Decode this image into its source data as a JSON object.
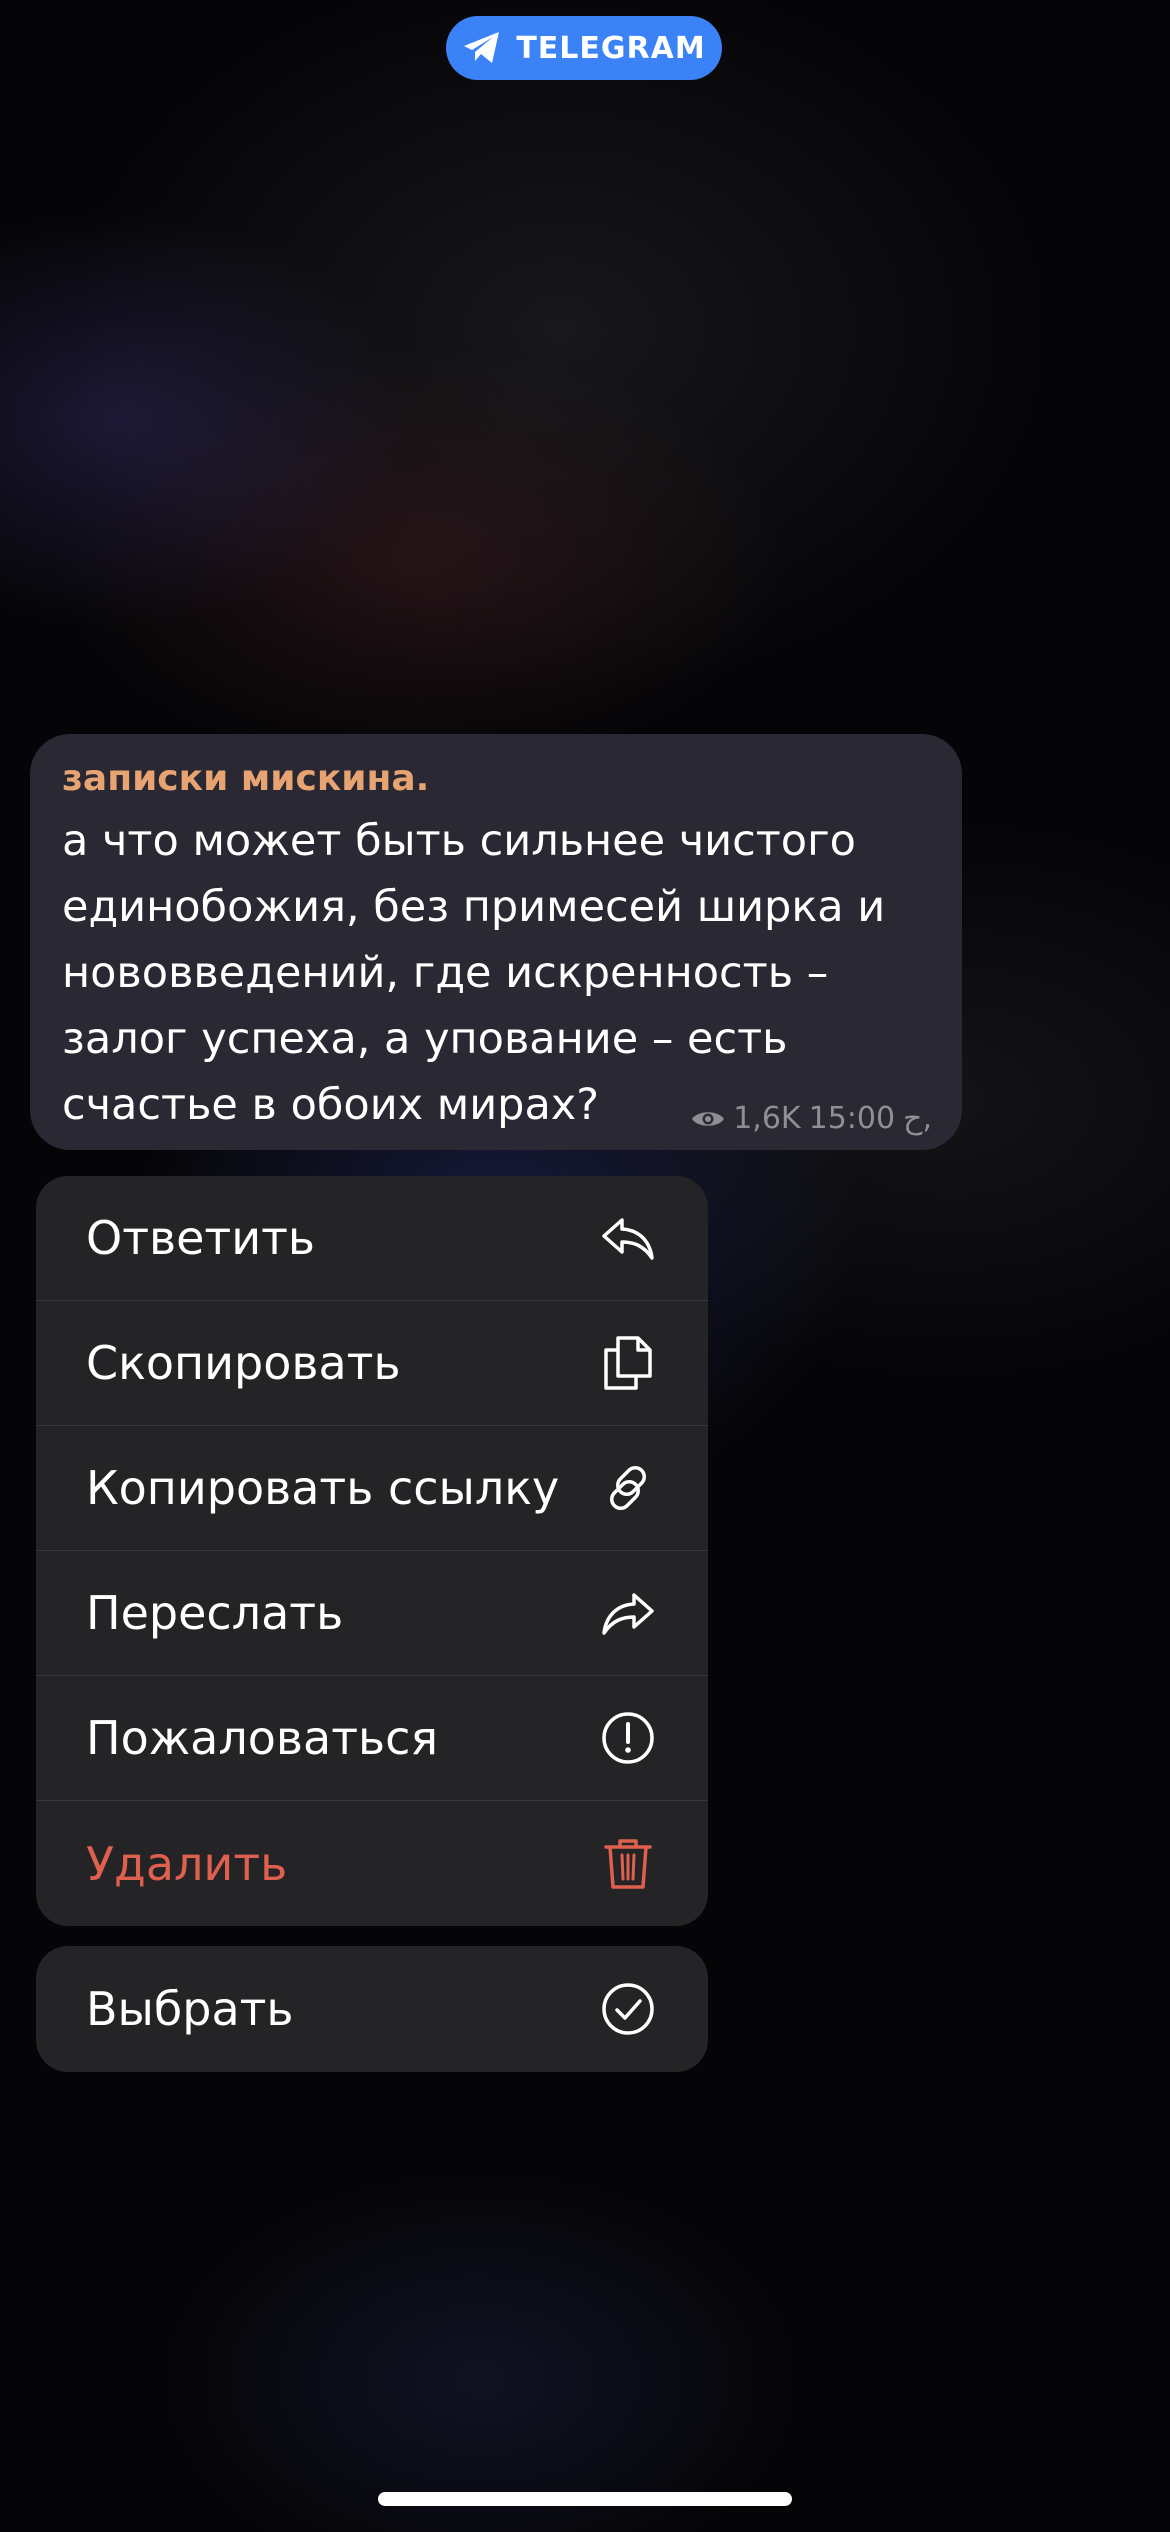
{
  "app": {
    "pill_label": "TELEGRAM",
    "pill_icon": "telegram-paper-plane-icon",
    "accent_color": "#3b82f6"
  },
  "message": {
    "author": "записки мискина.",
    "text": "а что может быть сильнее чистого единобожия, без примесей ширка и нововведений, где искренность – залог успеха, а упование – есть счастье в обоих мирах?",
    "views": "1,6K",
    "time": "15:00",
    "signature": "ح,",
    "author_color": "#e8a373"
  },
  "menu": {
    "items": [
      {
        "label": "Ответить",
        "icon": "reply-icon"
      },
      {
        "label": "Скопировать",
        "icon": "copy-icon"
      },
      {
        "label": "Копировать ссылку",
        "icon": "link-icon"
      },
      {
        "label": "Переслать",
        "icon": "forward-icon"
      },
      {
        "label": "Пожаловаться",
        "icon": "report-icon"
      },
      {
        "label": "Удалить",
        "icon": "trash-icon",
        "color": "#e0604f"
      }
    ],
    "select": {
      "label": "Выбрать",
      "icon": "checkmark-circle-icon"
    }
  }
}
